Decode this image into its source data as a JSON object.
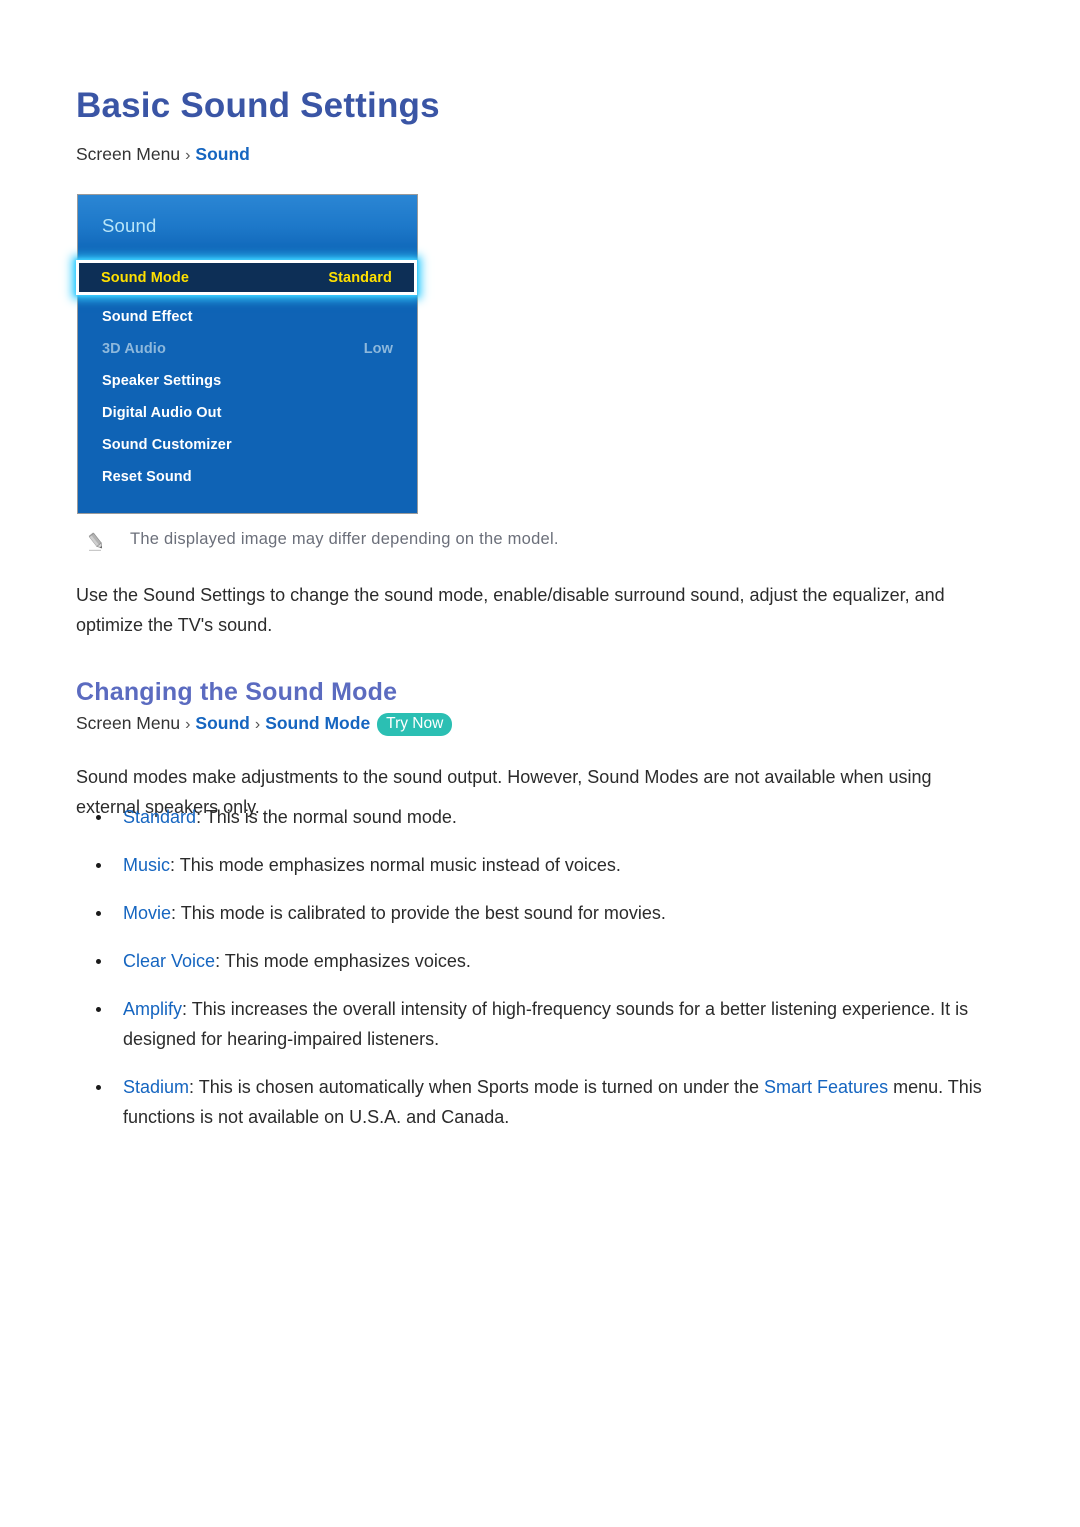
{
  "document": {
    "title": "Basic Sound Settings"
  },
  "breadcrumb_top": {
    "root": "Screen Menu",
    "separator": "›",
    "link1": "Sound"
  },
  "breadcrumb_section": {
    "root": "Screen Menu",
    "separator": "›",
    "link1": "Sound",
    "link2": "Sound Mode",
    "badge": "Try Now"
  },
  "tv_menu": {
    "panel_title": "Sound",
    "rows": [
      {
        "label": "Sound Mode",
        "value": "Standard",
        "state": "selected"
      },
      {
        "label": "Sound Effect",
        "value": "",
        "state": "normal"
      },
      {
        "label": "3D Audio",
        "value": "Low",
        "state": "disabled"
      },
      {
        "label": "Speaker Settings",
        "value": "",
        "state": "normal"
      },
      {
        "label": "Digital Audio Out",
        "value": "",
        "state": "normal"
      },
      {
        "label": "Sound Customizer",
        "value": "",
        "state": "normal"
      },
      {
        "label": "Reset Sound",
        "value": "",
        "state": "normal"
      }
    ]
  },
  "note": {
    "icon": "pencil-icon",
    "text": "The displayed image may differ depending on the model."
  },
  "intro_paragraph": "Use the Sound Settings to change the sound mode, enable/disable surround sound, adjust the equalizer, and optimize the TV's sound.",
  "section": {
    "heading": "Changing the Sound Mode",
    "paragraph": "Sound modes make adjustments to the sound output. However, Sound Modes are not available when using external speakers only."
  },
  "bullets": [
    {
      "term": "Standard",
      "rest": ": This is the normal sound mode."
    },
    {
      "term": "Music",
      "rest": ": This mode emphasizes normal music instead of voices."
    },
    {
      "term": "Movie",
      "rest": ": This mode is calibrated to provide the best sound for movies."
    },
    {
      "term": "Clear Voice",
      "rest": ": This mode emphasizes voices."
    },
    {
      "term": "Amplify",
      "rest": ": This increases the overall intensity of high-frequency sounds for a better listening experience. It is designed for hearing-impaired listeners."
    },
    {
      "term": "Stadium",
      "rest_before": ": This is chosen automatically when Sports mode is turned on under the ",
      "link": "Smart Features",
      "rest_after": " menu. This functions is not available on U.S.A. and Canada."
    }
  ],
  "colors": {
    "title": "#3a55a5",
    "section_heading": "#5b6bc0",
    "link": "#1565c0",
    "badge_bg": "#2bbfb3",
    "panel_blue": "#0f63b5",
    "selected_bg": "#0d2f56",
    "selected_text": "#ffe000",
    "glow": "#33ccff",
    "note_text": "#6b6f7a"
  }
}
